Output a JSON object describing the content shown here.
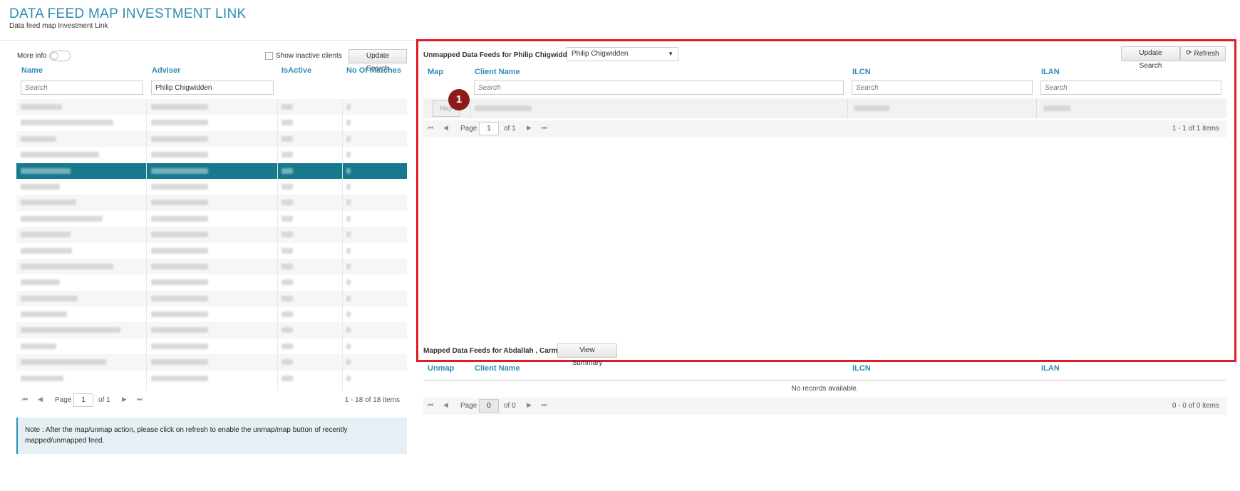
{
  "header": {
    "title": "DATA FEED MAP INVESTMENT LINK",
    "subtitle": "Data feed map Investment Link"
  },
  "left": {
    "more_info_label": "More info",
    "show_inactive_label": "Show inactive clients",
    "update_search_label": "Update Search",
    "columns": [
      "Name",
      "Adviser",
      "IsActive",
      "No Of Matches"
    ],
    "name_filter_placeholder": "Search",
    "adviser_filter_value": "Philip Chigwidden",
    "row_count": 18,
    "selected_row_index": 4,
    "pager": {
      "page_label": "Page",
      "page_value": "1",
      "of_label": "of 1",
      "info": "1 - 18 of 18 items"
    }
  },
  "note": {
    "text": "Note : After the map/unmap action, please click on refresh to enable the unmap/map button of recently mapped/unmapped feed."
  },
  "unmapped": {
    "title": "Unmapped Data Feeds for Philip Chigwidden",
    "adviser_select_value": "Philip Chigwidden",
    "update_search_label": "Update Search",
    "refresh_label": "Refresh",
    "columns": [
      "Map",
      "Client Name",
      "ILCN",
      "ILAN"
    ],
    "search_placeholder": "Search",
    "map_button_label": "Map",
    "annotation_number": "1",
    "pager": {
      "page_label": "Page",
      "page_value": "1",
      "of_label": "of 1",
      "info": "1 - 1 of 1 items"
    }
  },
  "mapped": {
    "title": "Mapped Data Feeds for Abdallah , Carmel",
    "view_summary_label": "View Summary",
    "columns": [
      "Unmap",
      "Client Name",
      "ILCN",
      "ILAN"
    ],
    "empty_text": "No records available.",
    "pager": {
      "page_label": "Page",
      "page_value": "0",
      "of_label": "of 0",
      "info": "0 - 0 of 0 items"
    }
  },
  "colors": {
    "accent": "#2e8db3",
    "selected_row": "#177a8c",
    "highlight_border": "#e31b23",
    "badge": "#8e1b1b"
  }
}
